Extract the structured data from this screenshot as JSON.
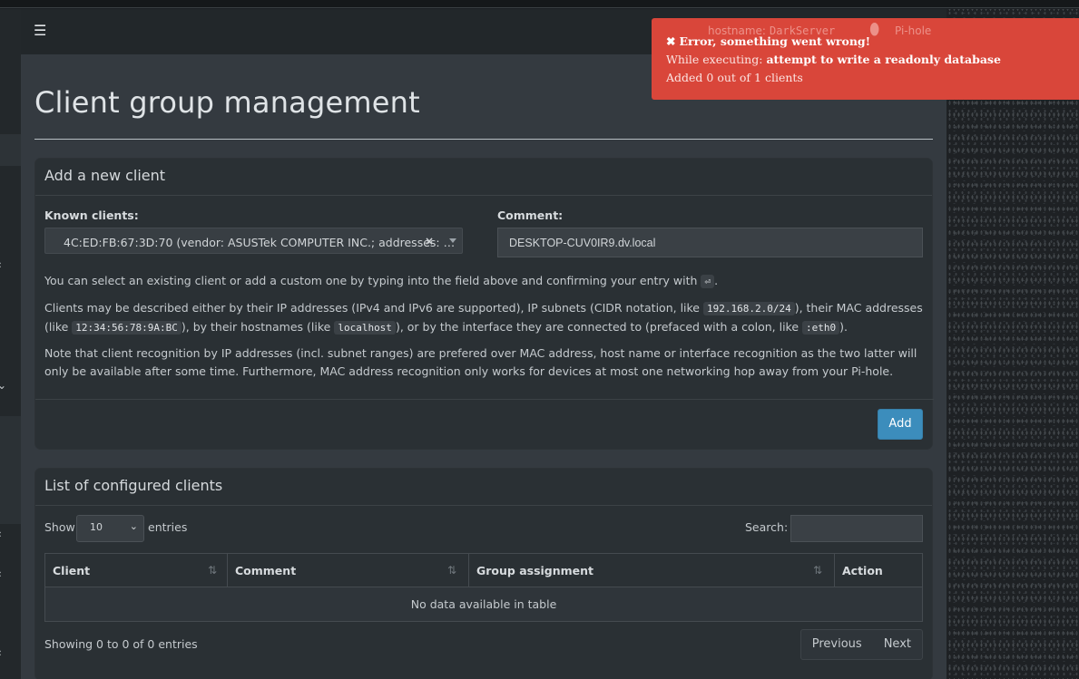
{
  "navbar": {
    "menu_icon": "hamburger-icon",
    "hostname_label": "hostname:",
    "hostname_value": "DarkServer",
    "brand": "Pi-hole"
  },
  "page": {
    "title": "Client group management"
  },
  "add_client": {
    "header": "Add a new client",
    "known_clients_label": "Known clients:",
    "known_clients_value": "4C:ED:FB:67:3D:70 (vendor: ASUSTek COMPUTER INC.; addresses: …",
    "clear_symbol": "×",
    "comment_label": "Comment:",
    "comment_value": "DESKTOP-CUV0IR9.dv.local",
    "help1_a": "You can select an existing client or add a custom one by typing into the field above and confirming your entry with",
    "help1_key": "⏎",
    "help1_b": ".",
    "help2_a": "Clients may be described either by their IP addresses (IPv4 and IPv6 are supported), IP subnets (CIDR notation, like",
    "help2_code1": "192.168.2.0/24",
    "help2_b": "), their MAC addresses (like",
    "help2_code2": "12:34:56:78:9A:BC",
    "help2_c": "), by their hostnames (like",
    "help2_code3": "localhost",
    "help2_d": "), or by the interface they are connected to (prefaced with a colon, like",
    "help2_code4": ":eth0",
    "help2_e": ").",
    "help3": "Note that client recognition by IP addresses (incl. subnet ranges) are prefered over MAC address, host name or interface recognition as the two latter will only be available after some time. Furthermore, MAC address recognition only works for devices at most one networking hop away from your Pi-hole.",
    "add_button": "Add"
  },
  "client_list": {
    "header": "List of configured clients",
    "show_label": "Show",
    "page_size": "10",
    "entries_label": "entries",
    "search_label": "Search:",
    "columns": [
      "Client",
      "Comment",
      "Group assignment",
      "Action"
    ],
    "sort_symbol": "⇅",
    "empty_message": "No data available in table",
    "info": "Showing 0 to 0 of 0 entries",
    "prev_label": "Previous",
    "next_label": "Next"
  },
  "toast": {
    "title": "Error, something went wrong!",
    "line2_prefix": "While executing:",
    "line2_detail": "attempt to write a readonly database",
    "line3": "Added 0 out of 1 clients",
    "close_symbol": "✖",
    "color": "#d9463a"
  },
  "colors": {
    "accent": "#3c8dbc",
    "background": "#343a40",
    "box": "#2a3034"
  }
}
